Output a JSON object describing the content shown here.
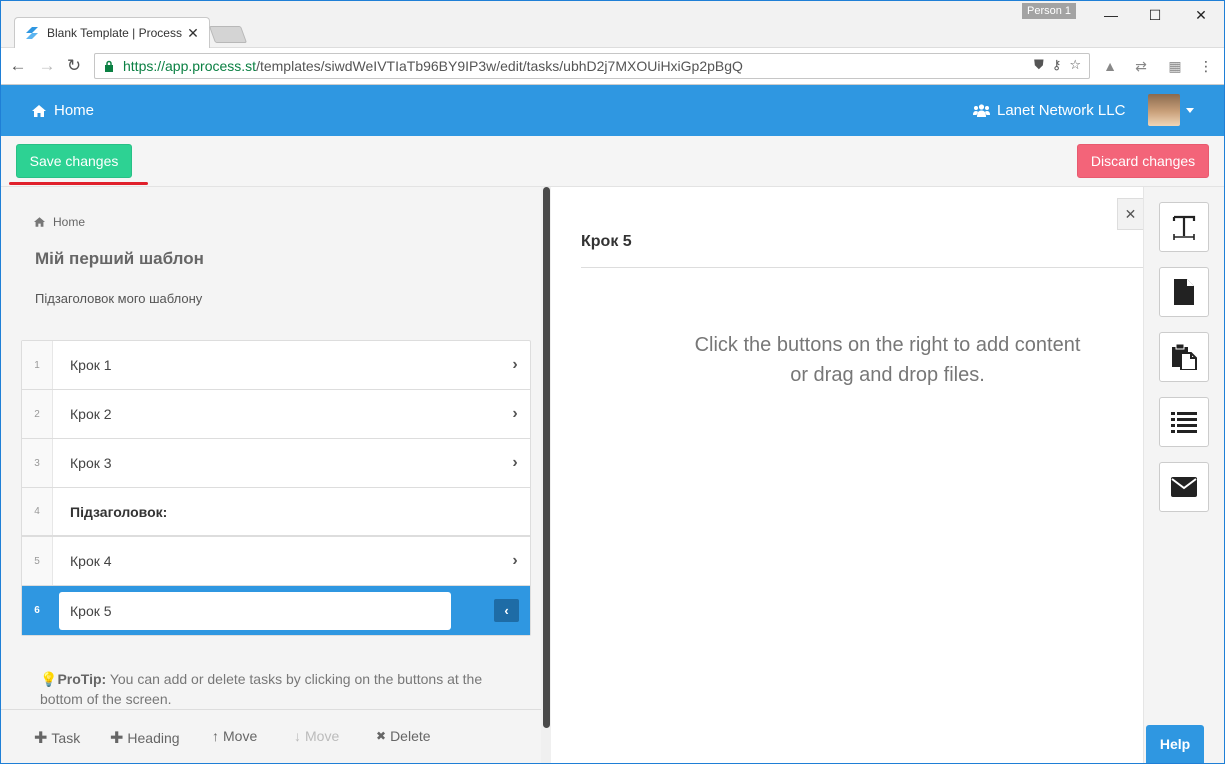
{
  "browser": {
    "tab_title": "Blank Template | Process",
    "tab_close": "✕",
    "person_label": "Person 1",
    "minimize": "—",
    "maximize": "☐",
    "close": "✕",
    "url_host": "https://app.process.st",
    "url_path": "/templates/siwdWeIVTIaTb96BY9IP3w/edit/tasks/ubhD2j7MXOUiHxiGp2pBgQ",
    "back": "←",
    "forward": "→",
    "reload": "↻"
  },
  "header": {
    "home_label": "Home",
    "org_label": "Lanet Network LLC"
  },
  "actions": {
    "save_label": "Save changes",
    "discard_label": "Discard changes"
  },
  "template": {
    "breadcrumb": "Home",
    "title": "Мій перший шаблон",
    "subtitle": "Підзаголовок мого шаблону"
  },
  "tasks": [
    {
      "num": "1",
      "name": "Крок 1"
    },
    {
      "num": "2",
      "name": "Крок 2"
    },
    {
      "num": "3",
      "name": "Крок 3"
    },
    {
      "num": "4",
      "name": "Підзаголовок:"
    },
    {
      "num": "5",
      "name": "Крок 4"
    },
    {
      "num": "6",
      "name": "Крок 5"
    }
  ],
  "protip": {
    "label": "ProTip:",
    "text": " You can add or delete tasks by clicking on the buttons at the bottom of the screen."
  },
  "bottom_bar": {
    "task": "Task",
    "heading": "Heading",
    "move_up": "Move",
    "move_down": "Move",
    "delete": "Delete"
  },
  "editor": {
    "step_title": "Крок 5",
    "empty_line1": "Click the buttons on the right to add content",
    "empty_line2": "or drag and drop files."
  },
  "help_label": "Help",
  "colors": {
    "primary": "#2f97e1",
    "save": "#2dd293",
    "discard": "#f36479"
  }
}
